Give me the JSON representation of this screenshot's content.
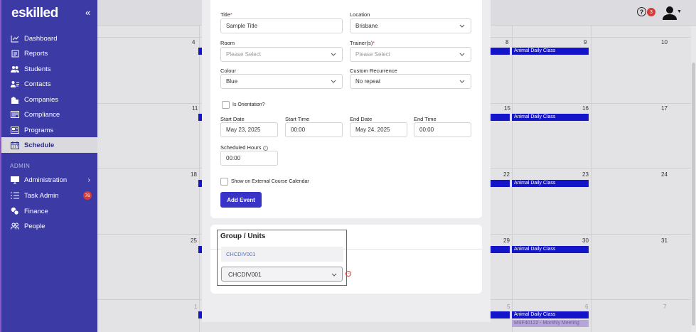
{
  "brand": {
    "logo_text": "eskilled"
  },
  "sidebar": {
    "items": [
      {
        "label": "Dashboard",
        "icon": "chart-line-icon"
      },
      {
        "label": "Reports",
        "icon": "report-icon"
      },
      {
        "label": "Students",
        "icon": "students-icon"
      },
      {
        "label": "Contacts",
        "icon": "contacts-icon"
      },
      {
        "label": "Companies",
        "icon": "building-icon"
      },
      {
        "label": "Compliance",
        "icon": "compliance-icon"
      },
      {
        "label": "Programs",
        "icon": "programs-icon"
      },
      {
        "label": "Schedule",
        "icon": "calendar-icon",
        "active": true
      }
    ],
    "admin_label": "ADMIN",
    "admin_items": [
      {
        "label": "Administration",
        "icon": "monitor-icon"
      },
      {
        "label": "Task Admin",
        "icon": "tasks-icon",
        "badge": "76"
      },
      {
        "label": "Finance",
        "icon": "coins-icon"
      },
      {
        "label": "People",
        "icon": "people-icon"
      }
    ]
  },
  "topbar": {
    "help_symbol": "?",
    "notifications": "3"
  },
  "calendar": {
    "row1": [
      "4",
      "8",
      "9",
      "10"
    ],
    "row2": [
      "11",
      "15",
      "16",
      "17"
    ],
    "row3": [
      "18",
      "22",
      "23",
      "24"
    ],
    "row4": [
      "25",
      "29",
      "30",
      "31"
    ],
    "row5": [
      "1",
      "5",
      "6",
      "7"
    ],
    "event_label": "Animal Daily Class",
    "meeting_label": "MSF40122 - Monthly Meeting"
  },
  "form": {
    "title_label": "Title",
    "title_value": "Sample Title",
    "location_label": "Location",
    "location_value": "Brisbane",
    "room_label": "Room",
    "room_placeholder": "Please Select",
    "trainers_label": "Trainer(s)",
    "trainers_placeholder": "Please Select",
    "colour_label": "Colour",
    "colour_value": "Blue",
    "recurrence_label": "Custom Recurrence",
    "recurrence_value": "No repeat",
    "orientation_label": "Is Orientation?",
    "start_date_label": "Start Date",
    "start_date_value": "May 23, 2025",
    "start_time_label": "Start Time",
    "start_time_value": "00:00",
    "end_date_label": "End Date",
    "end_date_value": "May 24, 2025",
    "end_time_label": "End Time",
    "end_time_value": "00:00",
    "hours_label": "Scheduled Hours",
    "hours_value": "00:00",
    "external_label": "Show on External Course Calendar",
    "add_button": "Add Event"
  },
  "group_units": {
    "title": "Group / Units",
    "suggestion": "CHCDIV001",
    "selected": "CHCDIV001"
  },
  "colors": {
    "sidebar": "#3c3ba6",
    "accent": "#3834c8",
    "event": "#1414c8",
    "badge": "#d63a3a"
  }
}
